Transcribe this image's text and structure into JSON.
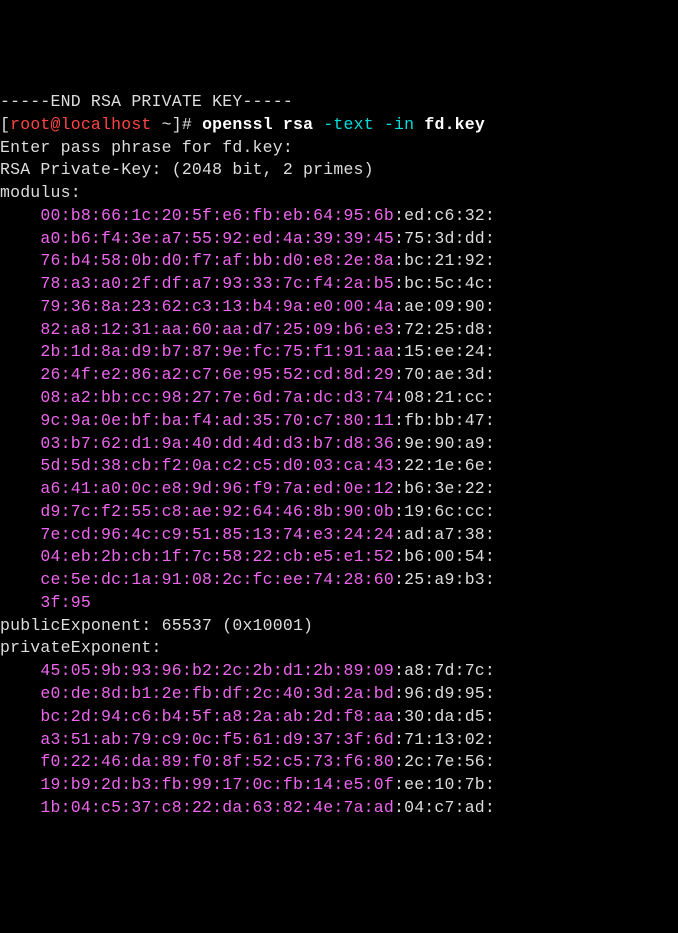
{
  "header_line": "-----END RSA PRIVATE KEY-----",
  "prompt": {
    "bracket_open": "[",
    "user": "root@localhost",
    "tilde": " ~",
    "bracket_close": "]# ",
    "cmd": "openssl rsa ",
    "flag1": "-text ",
    "flag2": "-in ",
    "arg": "fd.key"
  },
  "pass_phrase": "Enter pass phrase for fd.key:",
  "rsa_private_key": "RSA Private-Key: (2048 bit, 2 primes)",
  "modulus_label": "modulus:",
  "modulus_lines": [
    {
      "m": "00:b8:66:1c:20:5f:e6:fb:eb:64:95:6b",
      "w": ":ed:c6:32:"
    },
    {
      "m": "a0:b6:f4:3e:a7:55:92:ed:4a:39:39:45",
      "w": ":75:3d:dd:"
    },
    {
      "m": "76:b4:58:0b:d0:f7:af:bb:d0:e8:2e:8a",
      "w": ":bc:21:92:"
    },
    {
      "m": "78:a3:a0:2f:df:a7:93:33:7c:f4:2a:b5",
      "w": ":bc:5c:4c:"
    },
    {
      "m": "79:36:8a:23:62:c3:13:b4:9a:e0:00:4a",
      "w": ":ae:09:90:"
    },
    {
      "m": "82:a8:12:31:aa:60:aa:d7:25:09:b6:e3",
      "w": ":72:25:d8:"
    },
    {
      "m": "2b:1d:8a:d9:b7:87:9e:fc:75:f1:91:aa",
      "w": ":15:ee:24:"
    },
    {
      "m": "26:4f:e2:86:a2:c7:6e:95:52:cd:8d:29",
      "w": ":70:ae:3d:"
    },
    {
      "m": "08:a2:bb:cc:98:27:7e:6d:7a:dc:d3:74",
      "w": ":08:21:cc:"
    },
    {
      "m": "9c:9a:0e:bf:ba:f4:ad:35:70:c7:80:11",
      "w": ":fb:bb:47:"
    },
    {
      "m": "03:b7:62:d1:9a:40:dd:4d:d3:b7:d8:36",
      "w": ":9e:90:a9:"
    },
    {
      "m": "5d:5d:38:cb:f2:0a:c2:c5:d0:03:ca:43",
      "w": ":22:1e:6e:"
    },
    {
      "m": "a6:41:a0:0c:e8:9d:96:f9:7a:ed:0e:12",
      "w": ":b6:3e:22:"
    },
    {
      "m": "d9:7c:f2:55:c8:ae:92:64:46:8b:90:0b",
      "w": ":19:6c:cc:"
    },
    {
      "m": "7e:cd:96:4c:c9:51:85:13:74:e3:24:24",
      "w": ":ad:a7:38:"
    },
    {
      "m": "04:eb:2b:cb:1f:7c:58:22:cb:e5:e1:52",
      "w": ":b6:00:54:"
    },
    {
      "m": "ce:5e:dc:1a:91:08:2c:fc:ee:74:28:60",
      "w": ":25:a9:b3:"
    },
    {
      "m": "3f:95",
      "w": ""
    }
  ],
  "public_exponent": "publicExponent: 65537 (0x10001)",
  "private_exponent_label": "privateExponent:",
  "private_exponent_lines": [
    {
      "m": "45:05:9b:93:96:b2:2c:2b:d1:2b:89:09",
      "w": ":a8:7d:7c:"
    },
    {
      "m": "e0:de:8d:b1:2e:fb:df:2c:40:3d:2a:bd",
      "w": ":96:d9:95:"
    },
    {
      "m": "bc:2d:94:c6:b4:5f:a8:2a:ab:2d:f8:aa",
      "w": ":30:da:d5:"
    },
    {
      "m": "a3:51:ab:79:c9:0c:f5:61:d9:37:3f:6d",
      "w": ":71:13:02:"
    },
    {
      "m": "f0:22:46:da:89:f0:8f:52:c5:73:f6:80",
      "w": ":2c:7e:56:"
    },
    {
      "m": "19:b9:2d:b3:fb:99:17:0c:fb:14:e5:0f",
      "w": ":ee:10:7b:"
    },
    {
      "m": "1b:04:c5:37:c8:22:da:63:82:4e:7a:ad",
      "w": ":04:c7:ad:"
    }
  ],
  "indent": "    "
}
